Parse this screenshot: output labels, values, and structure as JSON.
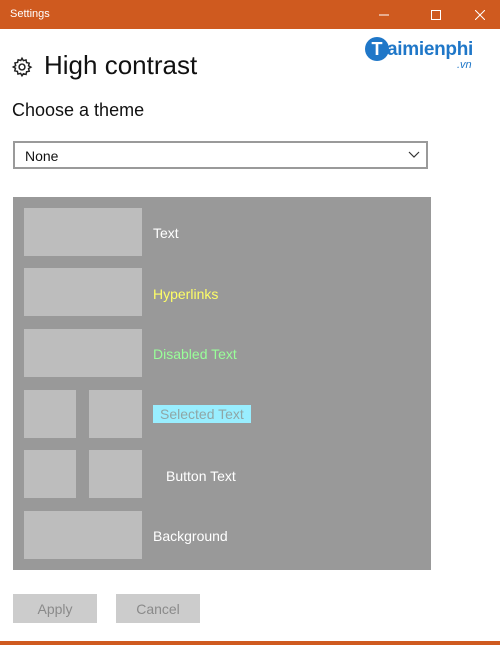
{
  "window": {
    "title": "Settings",
    "title_bar_color": "#cf5a1f"
  },
  "watermark": {
    "logo_letter": "T",
    "text": "aimienphi",
    "suffix": ".vn"
  },
  "header": {
    "title": "High contrast",
    "icon": "gear-icon"
  },
  "theme": {
    "heading": "Choose a theme",
    "selected": "None"
  },
  "preview": {
    "background_color": "#999999",
    "rows": [
      {
        "label": "Text",
        "color": "#ffffff"
      },
      {
        "label": "Hyperlinks",
        "color": "#ffff66"
      },
      {
        "label": "Disabled Text",
        "color": "#99ff99"
      },
      {
        "label": "Selected Text",
        "color": "#8fa6a6",
        "highlight": "#99eeff"
      },
      {
        "label": "Button Text",
        "color": "#ffffff"
      },
      {
        "label": "Background",
        "color": "#ffffff"
      }
    ]
  },
  "buttons": {
    "apply": "Apply",
    "cancel": "Cancel"
  }
}
